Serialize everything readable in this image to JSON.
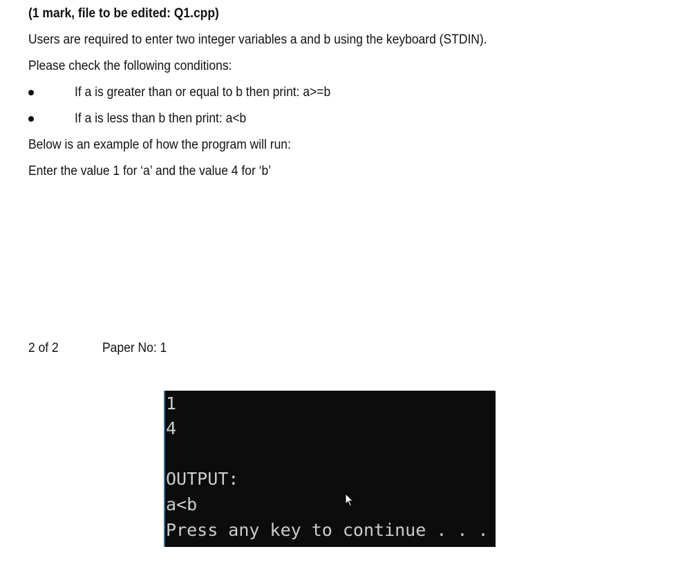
{
  "question": {
    "heading": "(1 mark, file to be edited: Q1.cpp)",
    "intro": "Users are required to enter two integer variables a and b using the keyboard (STDIN).",
    "check_prompt": "Please check the following conditions:",
    "conditions": [
      "If a is greater than or equal to b then print: a>=b",
      "If a is less than b then print: a<b"
    ],
    "example_intro": "Below is an example of how the program will run:",
    "example_input": "Enter the value 1 for ‘a’ and the value 4 for ‘b’"
  },
  "footer": {
    "page": "2 of 2",
    "paper": "Paper No: 1"
  },
  "console": {
    "lines": [
      "1",
      "4",
      "OUTPUT:",
      "a<b",
      "Press any key to continue . . ."
    ],
    "background": "#0c0c0c",
    "text_color": "#cccccc"
  },
  "icons": {
    "cursor": "mouse-pointer-icon"
  }
}
